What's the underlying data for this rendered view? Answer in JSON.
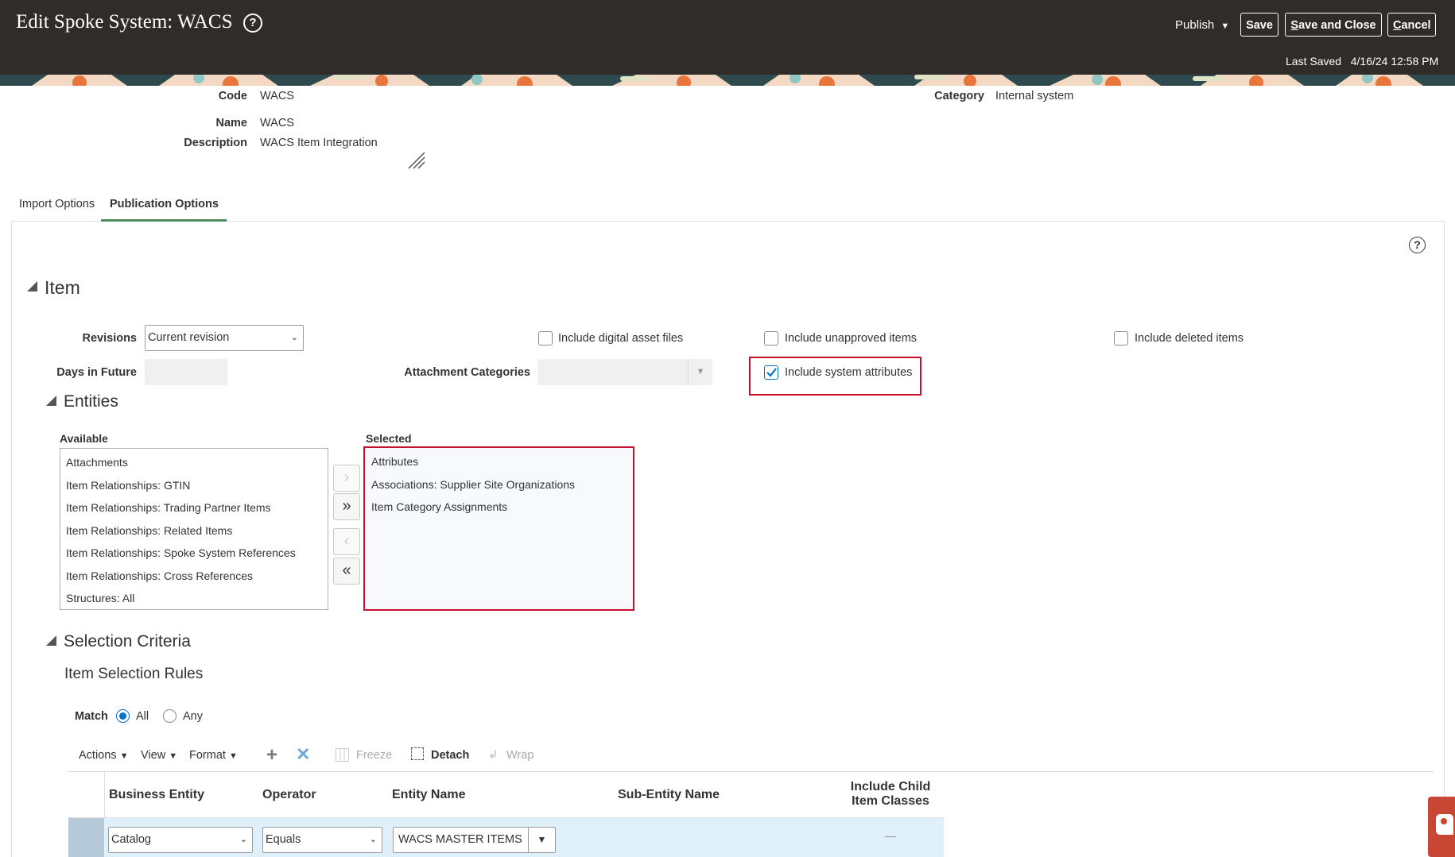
{
  "header": {
    "title": "Edit Spoke System: WACS",
    "publish_label": "Publish",
    "save_label": "Save",
    "save_close_label": "ave and Close",
    "save_close_accel": "S",
    "cancel_label": "ancel",
    "cancel_accel": "C",
    "last_saved_label": "Last Saved",
    "last_saved_value": "4/16/24 12:58 PM"
  },
  "fields": {
    "code_label": "Code",
    "code_value": "WACS",
    "name_label": "Name",
    "name_value": "WACS",
    "description_label": "Description",
    "description_value": "WACS Item Integration",
    "category_label": "Category",
    "category_value": "Internal system"
  },
  "tabs": [
    {
      "label": "Import Options",
      "active": false
    },
    {
      "label": "Publication Options",
      "active": true
    }
  ],
  "item": {
    "title": "Item",
    "revisions_label": "Revisions",
    "revisions_value": "Current revision",
    "days_future_label": "Days in Future",
    "days_future_value": "",
    "attachment_categories_label": "Attachment Categories",
    "attachment_categories_value": "",
    "checkboxes": {
      "digital_asset": {
        "label": "Include digital asset files",
        "checked": false
      },
      "unapproved": {
        "label": "Include unapproved items",
        "checked": false
      },
      "deleted": {
        "label": "Include deleted items",
        "checked": false
      },
      "system_attributes": {
        "label": "Include system attributes",
        "checked": true
      }
    }
  },
  "entities": {
    "title": "Entities",
    "available_label": "Available",
    "selected_label": "Selected",
    "available": [
      "Attachments",
      "Item Relationships: GTIN",
      "Item Relationships: Trading Partner Items",
      "Item Relationships: Related Items",
      "Item Relationships: Spoke System References",
      "Item Relationships: Cross References",
      "Structures: All"
    ],
    "selected": [
      "Attributes",
      "Associations: Supplier Site Organizations",
      "Item Category Assignments"
    ]
  },
  "selection_criteria": {
    "title": "Selection Criteria",
    "subtitle": "Item Selection Rules",
    "match_label": "Match",
    "match_all": "All",
    "match_any": "Any",
    "match_value": "All"
  },
  "toolbar": {
    "actions": "Actions",
    "view": "View",
    "format": "Format",
    "freeze": "Freeze",
    "detach": "Detach",
    "wrap": "Wrap"
  },
  "table": {
    "headers": {
      "business_entity": "Business Entity",
      "operator": "Operator",
      "entity_name": "Entity Name",
      "sub_entity_name": "Sub-Entity Name",
      "include_child_1": "Include Child",
      "include_child_2": "Item Classes"
    },
    "rows": [
      {
        "business_entity": "Catalog",
        "operator": "Equals",
        "entity_name": "WACS MASTER ITEMS",
        "sub_entity_name": "",
        "include_child": "—"
      }
    ]
  },
  "colors": {
    "header_bg": "#302c29",
    "accent_tab": "#4e8c5b",
    "highlight_red": "#c8102e",
    "row_selected": "#dff0fb",
    "checkbox_blue": "#0572ce"
  }
}
